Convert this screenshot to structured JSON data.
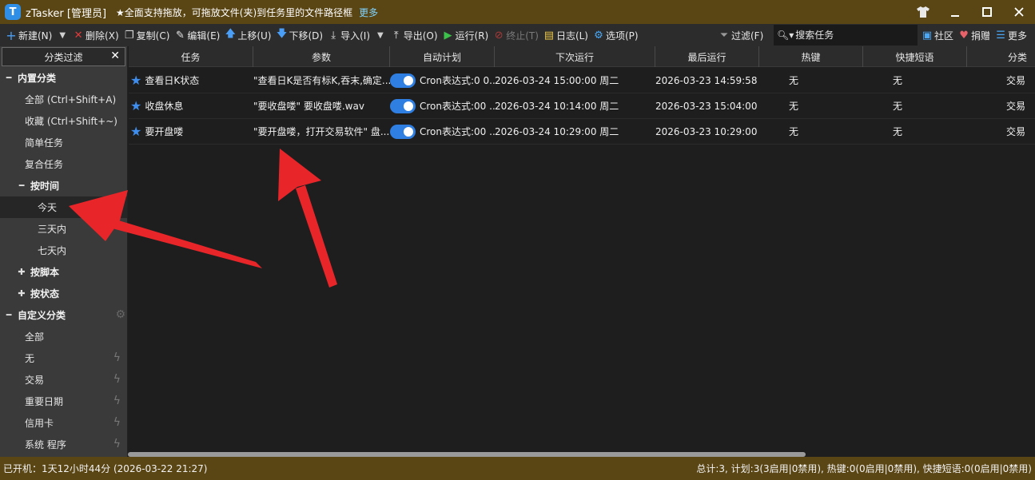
{
  "window": {
    "logo_letter": "T",
    "title": "zTasker [管理员]",
    "tip": "★全面支持拖放，可拖放文件(夹)到任务里的文件路径框",
    "more_link": "更多"
  },
  "toolbar": {
    "new_label": "新建(N)",
    "delete_label": "删除(X)",
    "copy_label": "复制(C)",
    "edit_label": "编辑(E)",
    "move_up_label": "上移(U)",
    "move_down_label": "下移(D)",
    "import_label": "导入(I)",
    "export_label": "导出(O)",
    "run_label": "运行(R)",
    "stop_label": "终止(T)",
    "log_label": "日志(L)",
    "options_label": "选项(P)",
    "filter_label": "过滤(F)",
    "search_placeholder": "搜索任务",
    "community_label": "社区",
    "donate_label": "捐赠",
    "more_label": "更多"
  },
  "sidebar": {
    "header": "分类过滤",
    "builtin": {
      "label": "内置分类",
      "items": [
        "全部 (Ctrl+Shift+A)",
        "收藏 (Ctrl+Shift+~)",
        "简单任务",
        "复合任务"
      ],
      "by_time": {
        "label": "按时间",
        "items": [
          "今天",
          "三天内",
          "七天内"
        ]
      },
      "by_script": "按脚本",
      "by_status": "按状态"
    },
    "custom": {
      "label": "自定义分类",
      "items": [
        "全部",
        "无",
        "交易",
        "重要日期",
        "信用卡",
        "系统 程序"
      ]
    }
  },
  "grid": {
    "columns": [
      "任务",
      "参数",
      "自动计划",
      "下次运行",
      "最后运行",
      "热键",
      "快捷短语",
      "分类"
    ],
    "rows": [
      {
        "task": "查看日K状态",
        "params": "\"查看日K是否有标K,吞末,确定...",
        "schedule": "Cron表达式:0 0...",
        "next_run": "2026-03-24 15:00:00 周二",
        "last_run": "2026-03-23 14:59:58",
        "hotkey": "无",
        "phrase": "无",
        "category": "交易"
      },
      {
        "task": "收盘休息",
        "params": "\"要收盘喽\" 要收盘喽.wav",
        "schedule": "Cron表达式:00 ...",
        "next_run": "2026-03-24 10:14:00 周二",
        "last_run": "2026-03-23 15:04:00",
        "hotkey": "无",
        "phrase": "无",
        "category": "交易"
      },
      {
        "task": "要开盘喽",
        "params": "\"要开盘喽，打开交易软件\" 盘...",
        "schedule": "Cron表达式:00 ...",
        "next_run": "2026-03-24 10:29:00 周二",
        "last_run": "2026-03-23 10:29:00",
        "hotkey": "无",
        "phrase": "无",
        "category": "交易"
      }
    ]
  },
  "statusbar": {
    "uptime": "已开机：1天12小时44分 (2026-03-22 21:27)",
    "summary": "总计:3, 计划:3(3启用|0禁用), 热键:0(0启用|0禁用), 快捷短语:0(0启用|0禁用)"
  },
  "colors": {
    "title_bar": "#5a4514",
    "accent_blue": "#2f7fe3",
    "arrow_red": "#e8262a"
  }
}
